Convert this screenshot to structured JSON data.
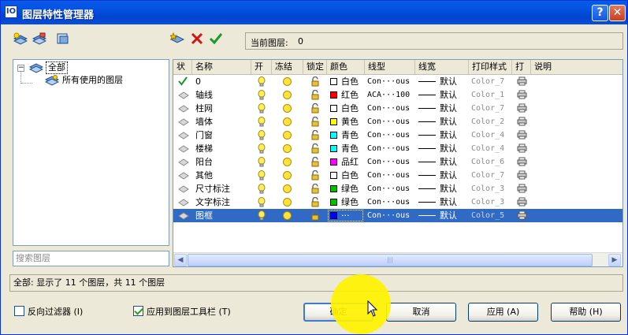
{
  "window": {
    "title": "图层特性管理器",
    "help_label": "?",
    "close_label": "✕",
    "app_icon_label": "IO"
  },
  "toolbar": {
    "current_layer_label": "当前图层:",
    "current_layer_value": "0"
  },
  "tree": {
    "root_expander": "−",
    "root_label": "全部",
    "child_label": "所有使用的图层"
  },
  "search": {
    "placeholder": "搜索图层"
  },
  "grid": {
    "columns": [
      "状",
      "名称",
      "开",
      "冻结",
      "锁定",
      "颜色",
      "线型",
      "线宽",
      "打印样式",
      "打",
      "说明"
    ],
    "rows": [
      {
        "name": "0",
        "color_name": "白色",
        "color": "#ffffff",
        "linetype": "Con···ous",
        "lineweight": "默认",
        "plotstyle": "Color_7",
        "current": true
      },
      {
        "name": "轴线",
        "color_name": "红色",
        "color": "#ff0000",
        "linetype": "ACA···100",
        "lineweight": "默认",
        "plotstyle": "Color_1"
      },
      {
        "name": "柱网",
        "color_name": "白色",
        "color": "#ffffff",
        "linetype": "Con···ous",
        "lineweight": "默认",
        "plotstyle": "Color_7"
      },
      {
        "name": "墙体",
        "color_name": "黄色",
        "color": "#ffff00",
        "linetype": "Con···ous",
        "lineweight": "默认",
        "plotstyle": "Color_2"
      },
      {
        "name": "门窗",
        "color_name": "青色",
        "color": "#00ffff",
        "linetype": "Con···ous",
        "lineweight": "默认",
        "plotstyle": "Color_4"
      },
      {
        "name": "楼梯",
        "color_name": "青色",
        "color": "#00ffff",
        "linetype": "Con···ous",
        "lineweight": "默认",
        "plotstyle": "Color_4"
      },
      {
        "name": "阳台",
        "color_name": "品红",
        "color": "#ff00ff",
        "linetype": "Con···ous",
        "lineweight": "默认",
        "plotstyle": "Color_6"
      },
      {
        "name": "其他",
        "color_name": "白色",
        "color": "#ffffff",
        "linetype": "Con···ous",
        "lineweight": "默认",
        "plotstyle": "Color_7"
      },
      {
        "name": "尺寸标注",
        "color_name": "绿色",
        "color": "#00c000",
        "linetype": "Con···ous",
        "lineweight": "默认",
        "plotstyle": "Color_3"
      },
      {
        "name": "文字标注",
        "color_name": "绿色",
        "color": "#00c000",
        "linetype": "Con···ous",
        "lineweight": "默认",
        "plotstyle": "Color_3"
      },
      {
        "name": "图框",
        "color_name": "···",
        "color": "#0000ff",
        "linetype": "Con···ous",
        "lineweight": "默认",
        "plotstyle": "Color_5",
        "selected": true
      }
    ]
  },
  "status": {
    "text": "全部: 显示了 11 个图层，共 11 个图层"
  },
  "options": {
    "invert_filter_label": "反向过滤器 (I)",
    "invert_filter_checked": false,
    "apply_toolbar_label": "应用到图层工具栏 (T)",
    "apply_toolbar_checked": true
  },
  "buttons": {
    "ok": "确定",
    "cancel": "取消",
    "apply": "应用 (A)",
    "help": "帮助 (H)"
  },
  "colors": {
    "title_bar": "#0554e3",
    "selection": "#316ac5",
    "face": "#ece9d8"
  }
}
